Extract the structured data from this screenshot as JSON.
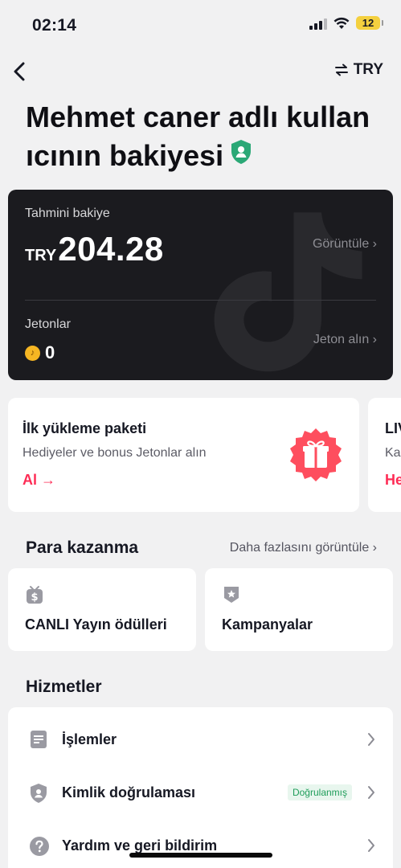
{
  "status_bar": {
    "time": "02:14",
    "battery": "12"
  },
  "nav": {
    "currency": "TRY"
  },
  "title": {
    "line1": "Mehmet caner adlı kullan",
    "line2": "ıcının bakiyesi"
  },
  "balance": {
    "label": "Tahmini bakiye",
    "currency": "TRY",
    "amount": "204.28",
    "view_link": "Görüntüle ›",
    "coins_label": "Jetonlar",
    "coins_value": "0",
    "buy_link": "Jeton alın ›"
  },
  "promo": {
    "title": "İlk yükleme paketi",
    "subtitle": "Hediyeler ve bonus Jetonlar alın",
    "cta": "Al →"
  },
  "promo2": {
    "title": "LIV",
    "subtitle": "Ka",
    "cta": "He"
  },
  "earn": {
    "title": "Para kazanma",
    "more_link": "Daha fazlasını görüntüle ›",
    "tiles": [
      {
        "label": "CANLI Yayın ödülleri",
        "icon": "live-gift-icon"
      },
      {
        "label": "Kampanyalar",
        "icon": "campaign-badge-icon"
      }
    ]
  },
  "services": {
    "title": "Hizmetler",
    "items": [
      {
        "label": "İşlemler",
        "icon": "document-icon"
      },
      {
        "label": "Kimlik doğrulaması",
        "icon": "shield-user-icon",
        "badge": "Doğrulanmış"
      },
      {
        "label": "Yardım ve geri bildirim",
        "icon": "help-icon"
      }
    ]
  },
  "colors": {
    "accent": "#fe2c55",
    "card_dark": "#1b1b1f",
    "verified": "#1f9d5a",
    "coin": "#f6b623"
  }
}
